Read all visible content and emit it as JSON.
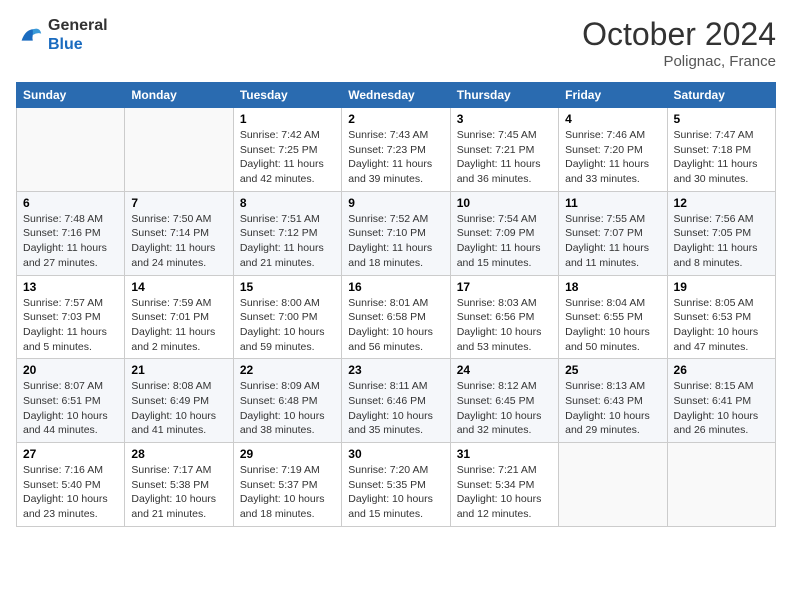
{
  "header": {
    "logo_line1": "General",
    "logo_line2": "Blue",
    "month_title": "October 2024",
    "subtitle": "Polignac, France"
  },
  "weekdays": [
    "Sunday",
    "Monday",
    "Tuesday",
    "Wednesday",
    "Thursday",
    "Friday",
    "Saturday"
  ],
  "weeks": [
    [
      {
        "day": "",
        "info": ""
      },
      {
        "day": "",
        "info": ""
      },
      {
        "day": "1",
        "info": "Sunrise: 7:42 AM\nSunset: 7:25 PM\nDaylight: 11 hours and 42 minutes."
      },
      {
        "day": "2",
        "info": "Sunrise: 7:43 AM\nSunset: 7:23 PM\nDaylight: 11 hours and 39 minutes."
      },
      {
        "day": "3",
        "info": "Sunrise: 7:45 AM\nSunset: 7:21 PM\nDaylight: 11 hours and 36 minutes."
      },
      {
        "day": "4",
        "info": "Sunrise: 7:46 AM\nSunset: 7:20 PM\nDaylight: 11 hours and 33 minutes."
      },
      {
        "day": "5",
        "info": "Sunrise: 7:47 AM\nSunset: 7:18 PM\nDaylight: 11 hours and 30 minutes."
      }
    ],
    [
      {
        "day": "6",
        "info": "Sunrise: 7:48 AM\nSunset: 7:16 PM\nDaylight: 11 hours and 27 minutes."
      },
      {
        "day": "7",
        "info": "Sunrise: 7:50 AM\nSunset: 7:14 PM\nDaylight: 11 hours and 24 minutes."
      },
      {
        "day": "8",
        "info": "Sunrise: 7:51 AM\nSunset: 7:12 PM\nDaylight: 11 hours and 21 minutes."
      },
      {
        "day": "9",
        "info": "Sunrise: 7:52 AM\nSunset: 7:10 PM\nDaylight: 11 hours and 18 minutes."
      },
      {
        "day": "10",
        "info": "Sunrise: 7:54 AM\nSunset: 7:09 PM\nDaylight: 11 hours and 15 minutes."
      },
      {
        "day": "11",
        "info": "Sunrise: 7:55 AM\nSunset: 7:07 PM\nDaylight: 11 hours and 11 minutes."
      },
      {
        "day": "12",
        "info": "Sunrise: 7:56 AM\nSunset: 7:05 PM\nDaylight: 11 hours and 8 minutes."
      }
    ],
    [
      {
        "day": "13",
        "info": "Sunrise: 7:57 AM\nSunset: 7:03 PM\nDaylight: 11 hours and 5 minutes."
      },
      {
        "day": "14",
        "info": "Sunrise: 7:59 AM\nSunset: 7:01 PM\nDaylight: 11 hours and 2 minutes."
      },
      {
        "day": "15",
        "info": "Sunrise: 8:00 AM\nSunset: 7:00 PM\nDaylight: 10 hours and 59 minutes."
      },
      {
        "day": "16",
        "info": "Sunrise: 8:01 AM\nSunset: 6:58 PM\nDaylight: 10 hours and 56 minutes."
      },
      {
        "day": "17",
        "info": "Sunrise: 8:03 AM\nSunset: 6:56 PM\nDaylight: 10 hours and 53 minutes."
      },
      {
        "day": "18",
        "info": "Sunrise: 8:04 AM\nSunset: 6:55 PM\nDaylight: 10 hours and 50 minutes."
      },
      {
        "day": "19",
        "info": "Sunrise: 8:05 AM\nSunset: 6:53 PM\nDaylight: 10 hours and 47 minutes."
      }
    ],
    [
      {
        "day": "20",
        "info": "Sunrise: 8:07 AM\nSunset: 6:51 PM\nDaylight: 10 hours and 44 minutes."
      },
      {
        "day": "21",
        "info": "Sunrise: 8:08 AM\nSunset: 6:49 PM\nDaylight: 10 hours and 41 minutes."
      },
      {
        "day": "22",
        "info": "Sunrise: 8:09 AM\nSunset: 6:48 PM\nDaylight: 10 hours and 38 minutes."
      },
      {
        "day": "23",
        "info": "Sunrise: 8:11 AM\nSunset: 6:46 PM\nDaylight: 10 hours and 35 minutes."
      },
      {
        "day": "24",
        "info": "Sunrise: 8:12 AM\nSunset: 6:45 PM\nDaylight: 10 hours and 32 minutes."
      },
      {
        "day": "25",
        "info": "Sunrise: 8:13 AM\nSunset: 6:43 PM\nDaylight: 10 hours and 29 minutes."
      },
      {
        "day": "26",
        "info": "Sunrise: 8:15 AM\nSunset: 6:41 PM\nDaylight: 10 hours and 26 minutes."
      }
    ],
    [
      {
        "day": "27",
        "info": "Sunrise: 7:16 AM\nSunset: 5:40 PM\nDaylight: 10 hours and 23 minutes."
      },
      {
        "day": "28",
        "info": "Sunrise: 7:17 AM\nSunset: 5:38 PM\nDaylight: 10 hours and 21 minutes."
      },
      {
        "day": "29",
        "info": "Sunrise: 7:19 AM\nSunset: 5:37 PM\nDaylight: 10 hours and 18 minutes."
      },
      {
        "day": "30",
        "info": "Sunrise: 7:20 AM\nSunset: 5:35 PM\nDaylight: 10 hours and 15 minutes."
      },
      {
        "day": "31",
        "info": "Sunrise: 7:21 AM\nSunset: 5:34 PM\nDaylight: 10 hours and 12 minutes."
      },
      {
        "day": "",
        "info": ""
      },
      {
        "day": "",
        "info": ""
      }
    ]
  ]
}
